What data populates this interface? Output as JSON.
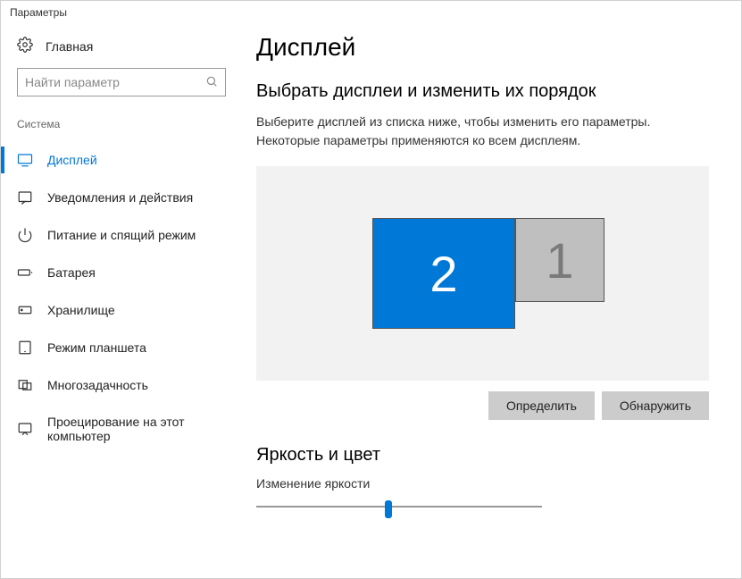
{
  "window_title": "Параметры",
  "sidebar": {
    "home": "Главная",
    "search_placeholder": "Найти параметр",
    "category": "Система",
    "items": [
      {
        "label": "Дисплей"
      },
      {
        "label": "Уведомления и действия"
      },
      {
        "label": "Питание и спящий режим"
      },
      {
        "label": "Батарея"
      },
      {
        "label": "Хранилище"
      },
      {
        "label": "Режим планшета"
      },
      {
        "label": "Многозадачность"
      },
      {
        "label": "Проецирование на этот компьютер"
      }
    ]
  },
  "main": {
    "title": "Дисплей",
    "section_heading": "Выбрать дисплеи и изменить их порядок",
    "description": "Выберите дисплей из списка ниже, чтобы изменить его параметры. Некоторые параметры применяются ко всем дисплеям.",
    "displays": {
      "selected": "2",
      "other": "1"
    },
    "identify_btn": "Определить",
    "detect_btn": "Обнаружить",
    "brightness_section": "Яркость и цвет",
    "brightness_label": "Изменение яркости",
    "brightness_value_percent": 45
  },
  "colors": {
    "accent": "#0078d7"
  }
}
